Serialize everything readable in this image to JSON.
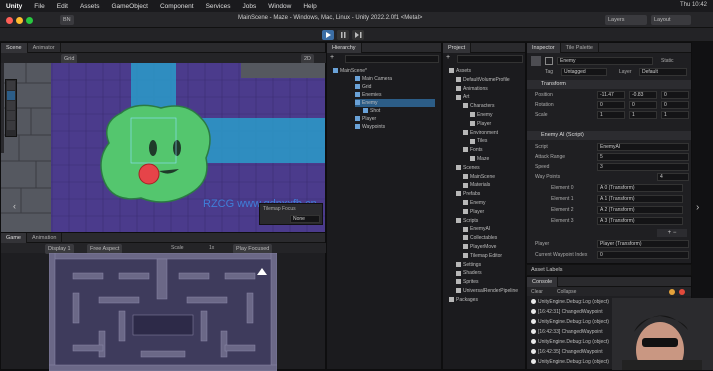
{
  "menubar": {
    "app": "Unity",
    "items": [
      "File",
      "Edit",
      "Assets",
      "GameObject",
      "Component",
      "Services",
      "Jobs",
      "Window",
      "Help"
    ],
    "clock": "Thu 10:42"
  },
  "window": {
    "title": "MainScene - Maze - Windows, Mac, Linux - Unity 2022.2.0f1 <Metal>",
    "account": "BN",
    "search": "",
    "layers": "Layers",
    "layout": "Layout"
  },
  "scene": {
    "tab_scene": "Scene",
    "tab_animator": "Animator",
    "shading": "2D",
    "grid_tool": "Grid",
    "overlay_label": "Tilemap Focus",
    "overlay_value": "None",
    "watermark": "RZCG www.qdnxxfb.cn"
  },
  "game": {
    "tab_game": "Game",
    "tab_animation": "Animation",
    "display": "Display 1",
    "aspect": "Free Aspect",
    "scale_label": "Scale",
    "scale_value": "1x",
    "play_mode": "Play Focused"
  },
  "hierarchy": {
    "tab": "Hierarchy",
    "items": [
      {
        "label": "MainScene*",
        "depth": 0
      },
      {
        "label": "Main Camera",
        "depth": 1
      },
      {
        "label": "Grid",
        "depth": 1
      },
      {
        "label": "Enemies",
        "depth": 1
      },
      {
        "label": "Enemy",
        "depth": 1
      },
      {
        "label": "Shot",
        "depth": 2
      },
      {
        "label": "Player",
        "depth": 1
      },
      {
        "label": "Waypoints",
        "depth": 1
      }
    ]
  },
  "project": {
    "tab": "Project",
    "items": [
      {
        "label": "Assets",
        "depth": 0
      },
      {
        "label": "DefaultVolumeProfile",
        "depth": 1
      },
      {
        "label": "Animations",
        "depth": 1
      },
      {
        "label": "Art",
        "depth": 1
      },
      {
        "label": "Characters",
        "depth": 2
      },
      {
        "label": "Enemy",
        "depth": 3
      },
      {
        "label": "Player",
        "depth": 3
      },
      {
        "label": "Environment",
        "depth": 2
      },
      {
        "label": "Tiles",
        "depth": 3
      },
      {
        "label": "Fonts",
        "depth": 2
      },
      {
        "label": "Maze",
        "depth": 3
      },
      {
        "label": "Scenes",
        "depth": 1
      },
      {
        "label": "MainScene",
        "depth": 2
      },
      {
        "label": "Materials",
        "depth": 2
      },
      {
        "label": "Prefabs",
        "depth": 1
      },
      {
        "label": "Enemy",
        "depth": 2
      },
      {
        "label": "Player",
        "depth": 2
      },
      {
        "label": "Scripts",
        "depth": 1
      },
      {
        "label": "EnemyAI",
        "depth": 2
      },
      {
        "label": "Collectables",
        "depth": 2
      },
      {
        "label": "PlayerMove",
        "depth": 2
      },
      {
        "label": "Tilemap Editor",
        "depth": 2
      },
      {
        "label": "Settings",
        "depth": 1
      },
      {
        "label": "Shaders",
        "depth": 1
      },
      {
        "label": "Sprites",
        "depth": 1
      },
      {
        "label": "UniversalRenderPipeline",
        "depth": 1
      },
      {
        "label": "Packages",
        "depth": 0
      }
    ]
  },
  "inspector": {
    "tab": "Inspector",
    "tab2": "Tile Palette",
    "object_name": "Enemy",
    "static": "Static",
    "tag_label": "Tag",
    "tag_value": "Untagged",
    "layer_label": "Layer",
    "layer_value": "Default",
    "transform": {
      "title": "Transform",
      "position_label": "Position",
      "rotation_label": "Rotation",
      "scale_label": "Scale",
      "position": [
        "-11.47",
        "-0.83",
        "0"
      ],
      "rotation": [
        "0",
        "0",
        "0"
      ],
      "scale": [
        "1",
        "1",
        "1"
      ]
    },
    "script": {
      "title": "Enemy AI (Script)",
      "script_label": "Script",
      "script_value": "EnemyAI",
      "attack_label": "Attack Range",
      "attack_value": "5",
      "speed_label": "Speed",
      "speed_value": "3",
      "waypoints_label": "Way Points",
      "waypoints_count": "4",
      "elements": [
        {
          "label": "Element 0",
          "value": "A 0 (Transform)"
        },
        {
          "label": "Element 1",
          "value": "A 1 (Transform)"
        },
        {
          "label": "Element 2",
          "value": "A 2 (Transform)"
        },
        {
          "label": "Element 3",
          "value": "A 3 (Transform)"
        }
      ],
      "player_label": "Player",
      "player_value": "Player (Transform)",
      "waypoint_index_label": "Current Waypoint Index",
      "waypoint_index_value": "0"
    },
    "asset_labels": "Asset Labels"
  },
  "console": {
    "tab": "Console",
    "clear": "Clear",
    "collapse": "Collapse",
    "messages": [
      "UnityEngine.Debug:Log (object)",
      "[16:42:31] ChangedWaypoint",
      "UnityEngine.Debug:Log (object)",
      "[16:42:33] ChangedWaypoint",
      "UnityEngine.Debug:Log (object)",
      "[16:42:35] ChangedWaypoint",
      "UnityEngine.Debug:Log (object)"
    ]
  },
  "colors": {
    "accent": "#2c5d87",
    "slime": "#54c66e",
    "background": "#4b3b8c",
    "path": "#2a9cc9"
  }
}
